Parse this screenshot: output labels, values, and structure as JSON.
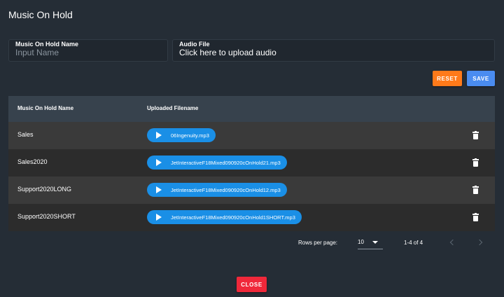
{
  "dialog": {
    "title": "Music On Hold"
  },
  "form": {
    "name_label": "Music On Hold Name",
    "name_placeholder": "Input Name",
    "audio_label": "Audio File",
    "audio_value": "Click here to upload audio",
    "reset_label": "RESET",
    "save_label": "SAVE"
  },
  "table": {
    "columns": [
      "Music On Hold Name",
      "Uploaded Filename"
    ],
    "rows": [
      {
        "name": "Sales",
        "file": "06Ingenuity.mp3"
      },
      {
        "name": "Sales2020",
        "file": "JetInteractiveF18Mixed090920cOnHold21.mp3"
      },
      {
        "name": "Support2020LONG",
        "file": "JetInteractiveF18Mixed090920cOnHold12.mp3"
      },
      {
        "name": "Support2020SHORT",
        "file": "JetInteractiveF18Mixed090920cOnHold1SHORT.mp3"
      }
    ]
  },
  "pagination": {
    "rows_per_page_label": "Rows per page:",
    "rows_per_page": "10",
    "range": "1-4 of 4"
  },
  "actions": {
    "close_label": "CLOSE"
  },
  "colors": {
    "background": "#252d36",
    "reset": "#ff7a1a",
    "save": "#4a8cf0",
    "play": "#1a8fe6",
    "close": "#f0283a"
  },
  "icons": [
    "play-icon",
    "trash-icon",
    "chevron-down-icon",
    "chevron-left-icon",
    "chevron-right-icon"
  ]
}
